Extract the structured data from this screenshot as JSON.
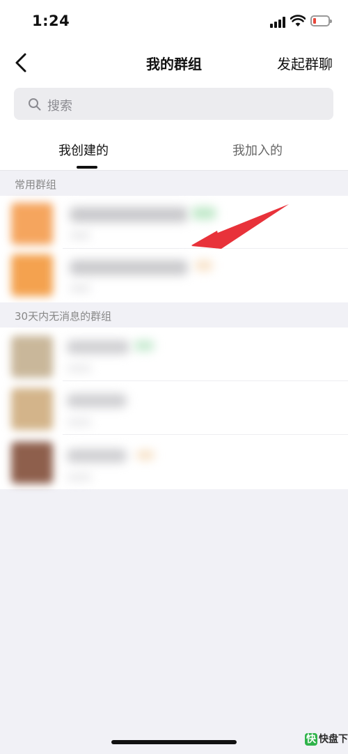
{
  "status_bar": {
    "time": "1:24"
  },
  "header": {
    "title": "我的群组",
    "action_label": "发起群聊"
  },
  "search": {
    "placeholder": "搜索"
  },
  "tabs": [
    {
      "label": "我创建的",
      "selected": true
    },
    {
      "label": "我加入的",
      "selected": false
    }
  ],
  "sections": [
    {
      "title": "常用群组",
      "rows": 2
    },
    {
      "title": "30天内无消息的群组",
      "rows": 3
    }
  ],
  "watermark": {
    "brand": "快盘下载",
    "logo_glyph": "快"
  },
  "colors": {
    "arrow": "#e8323a",
    "background": "#f1f1f6",
    "battery_low": "#e8473b"
  }
}
